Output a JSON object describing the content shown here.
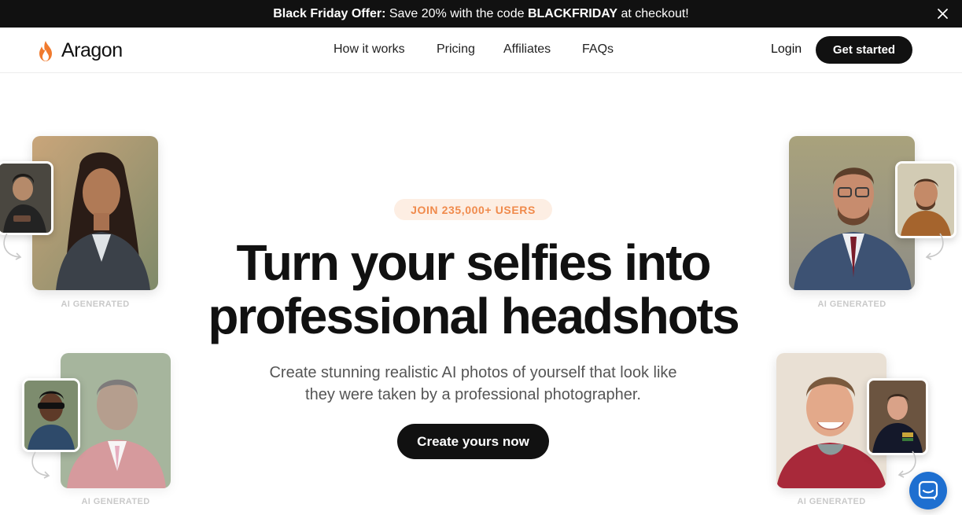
{
  "promo": {
    "prefix": "Black Friday Offer:",
    "middle": " Save 20% with the code ",
    "code": "BLACKFRIDAY",
    "suffix": " at checkout!",
    "close_icon": "close-icon"
  },
  "header": {
    "logo_text": "Aragon",
    "logo_icon": "flame-icon",
    "nav": [
      {
        "label": "How it works"
      },
      {
        "label": "Pricing"
      },
      {
        "label": "Affiliates"
      },
      {
        "label": "FAQs"
      }
    ],
    "login": "Login",
    "get_started": "Get started"
  },
  "hero": {
    "badge": "JOIN 235,000+ USERS",
    "headline_line1": "Turn your selfies into",
    "headline_line2": "professional headshots",
    "subhead_line1": "Create stunning realistic AI photos of yourself that look like",
    "subhead_line2": "they were taken by a professional photographer.",
    "cta": "Create yours now"
  },
  "samples": {
    "label": "AI GENERATED"
  },
  "chat": {
    "icon": "chat-icon"
  },
  "colors": {
    "brand_dark": "#111111",
    "accent_orange": "#f08a4b",
    "badge_bg": "#fdeee3",
    "chat_blue": "#1e6fd0"
  }
}
